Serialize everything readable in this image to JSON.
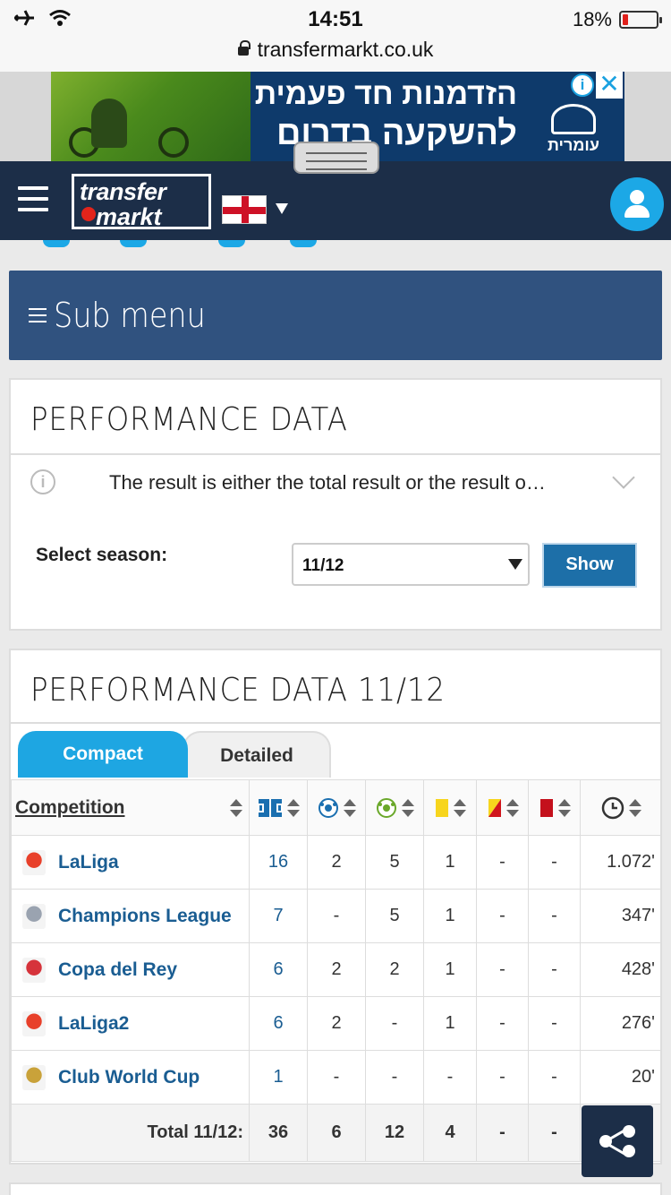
{
  "status": {
    "time": "14:51",
    "battery": "18%",
    "battery_level": 0.18
  },
  "url": "transfermarkt.co.uk",
  "ad": {
    "line1": "הזדמנות חד פעמית",
    "line2": "להשקעה בדרום",
    "brand": "עומרית",
    "info": "i",
    "close": "✕"
  },
  "header": {
    "logo_line1": "transfer",
    "logo_line2": "markt"
  },
  "submenu": {
    "label": "Sub menu"
  },
  "performance": {
    "title": "PERFORMANCE DATA",
    "info_icon": "i",
    "info_text": "The result is either the total result or the result o…",
    "season_label": "Select season:",
    "season_value": "11/12",
    "show_label": "Show"
  },
  "perf_season": {
    "title": "PERFORMANCE DATA 11/12",
    "tabs": {
      "compact": "Compact",
      "detailed": "Detailed"
    },
    "col_competition": "Competition",
    "rows": [
      {
        "name": "LaLiga",
        "apps": "16",
        "goals": "2",
        "assists": "5",
        "yellow": "1",
        "second_yellow": "-",
        "red": "-",
        "minutes": "1.072'",
        "logo": "laliga-logo",
        "logo_color": "#e8402a"
      },
      {
        "name": "Champions League",
        "apps": "7",
        "goals": "-",
        "assists": "5",
        "yellow": "1",
        "second_yellow": "-",
        "red": "-",
        "minutes": "347'",
        "logo": "champions-league-logo",
        "logo_color": "#9aa3b0"
      },
      {
        "name": "Copa del Rey",
        "apps": "6",
        "goals": "2",
        "assists": "2",
        "yellow": "1",
        "second_yellow": "-",
        "red": "-",
        "minutes": "428'",
        "logo": "copa-del-rey-logo",
        "logo_color": "#d6333b"
      },
      {
        "name": "LaLiga2",
        "apps": "6",
        "goals": "2",
        "assists": "-",
        "yellow": "1",
        "second_yellow": "-",
        "red": "-",
        "minutes": "276'",
        "logo": "laliga2-logo",
        "logo_color": "#e8402a"
      },
      {
        "name": "Club World Cup",
        "apps": "1",
        "goals": "-",
        "assists": "-",
        "yellow": "-",
        "second_yellow": "-",
        "red": "-",
        "minutes": "20'",
        "logo": "club-world-cup-logo",
        "logo_color": "#c9a23a"
      }
    ],
    "total": {
      "label": "Total 11/12:",
      "apps": "36",
      "goals": "6",
      "assists": "12",
      "yellow": "4",
      "second_yellow": "-",
      "red": "-"
    }
  },
  "colors": {
    "navy": "#1c2e48",
    "submenu": "#30527f",
    "accent": "#1ea6e2",
    "link": "#1a5d92"
  }
}
